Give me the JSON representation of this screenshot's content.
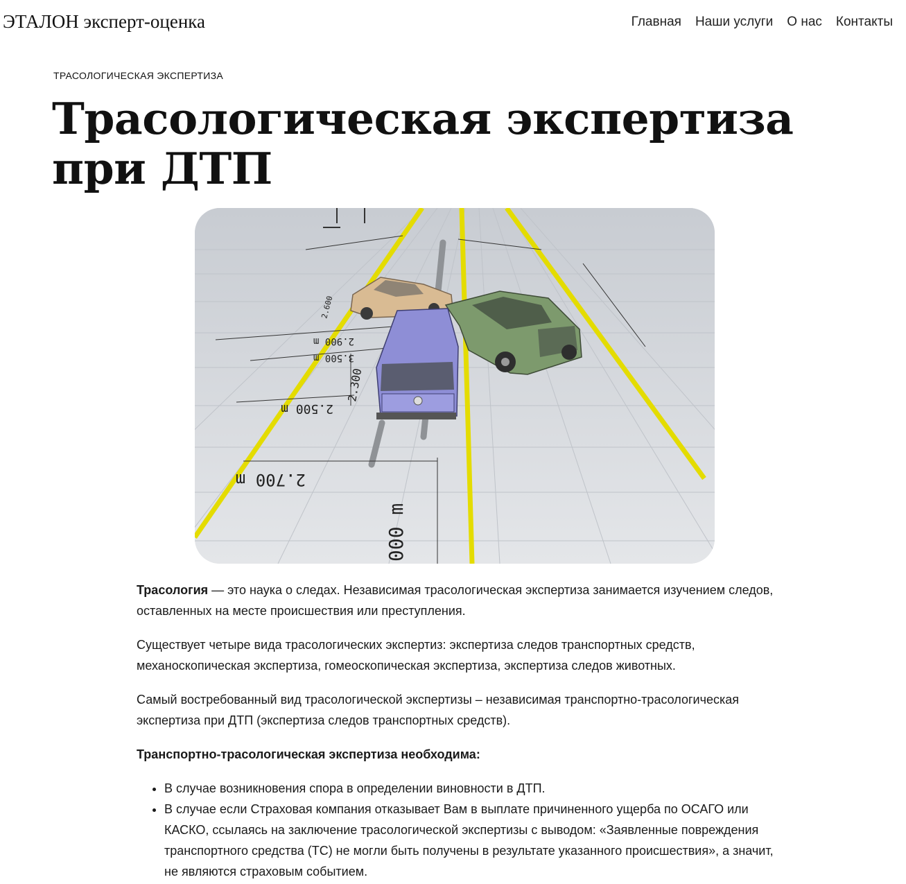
{
  "site": {
    "title": "ЭТАЛОН эксперт-оценка"
  },
  "nav": {
    "items": [
      "Главная",
      "Наши услуги",
      "О нас",
      "Контакты"
    ]
  },
  "page": {
    "category": "ТРАСОЛОГИЧЕСКАЯ ЭКСПЕРТИЗА",
    "title": "Трасологическая экспертиза при ДТП"
  },
  "hero_image": {
    "measurements": [
      "2.900 m",
      "3.500 m",
      "2.500 m",
      "2.700 m",
      "2.300",
      "2.600",
      "000 m"
    ]
  },
  "article": {
    "p1_bold": "Трасология",
    "p1_rest": " — это наука о следах. Независимая трасологическая экспертиза занимается изучением следов, оставленных на месте происшествия или преступления.",
    "p2": "Существует четыре вида трасологических экспертиз: экспертиза следов транспортных средств, механоскопическая экспертиза, гомеоскопическая экспертиза, экспертиза следов животных.",
    "p3": "Самый востребованный вид трасологической экспертизы – независимая транспортно-трасологическая экспертиза при ДТП (экспертиза следов транспортных средств).",
    "p4_bold": "Транспортно-трасологическая экспертиза необходима",
    "p4_colon": ":",
    "list": [
      "В случае возникновения спора в определении виновности в ДТП.",
      "В случае если Страховая компания отказывает Вам в выплате причиненного ущерба по ОСАГО или КАСКО, ссылаясь на заключение трасологической экспертизы с выводом: «Заявленные повреждения транспортного средства (ТС) не могли быть получены в результате указанного происшествия», а значит, не являются страховым событием."
    ]
  },
  "colors": {
    "background": "#ffffff",
    "text": "#111111",
    "road_line": "#e4dc00",
    "ground": "#d8dadd"
  }
}
